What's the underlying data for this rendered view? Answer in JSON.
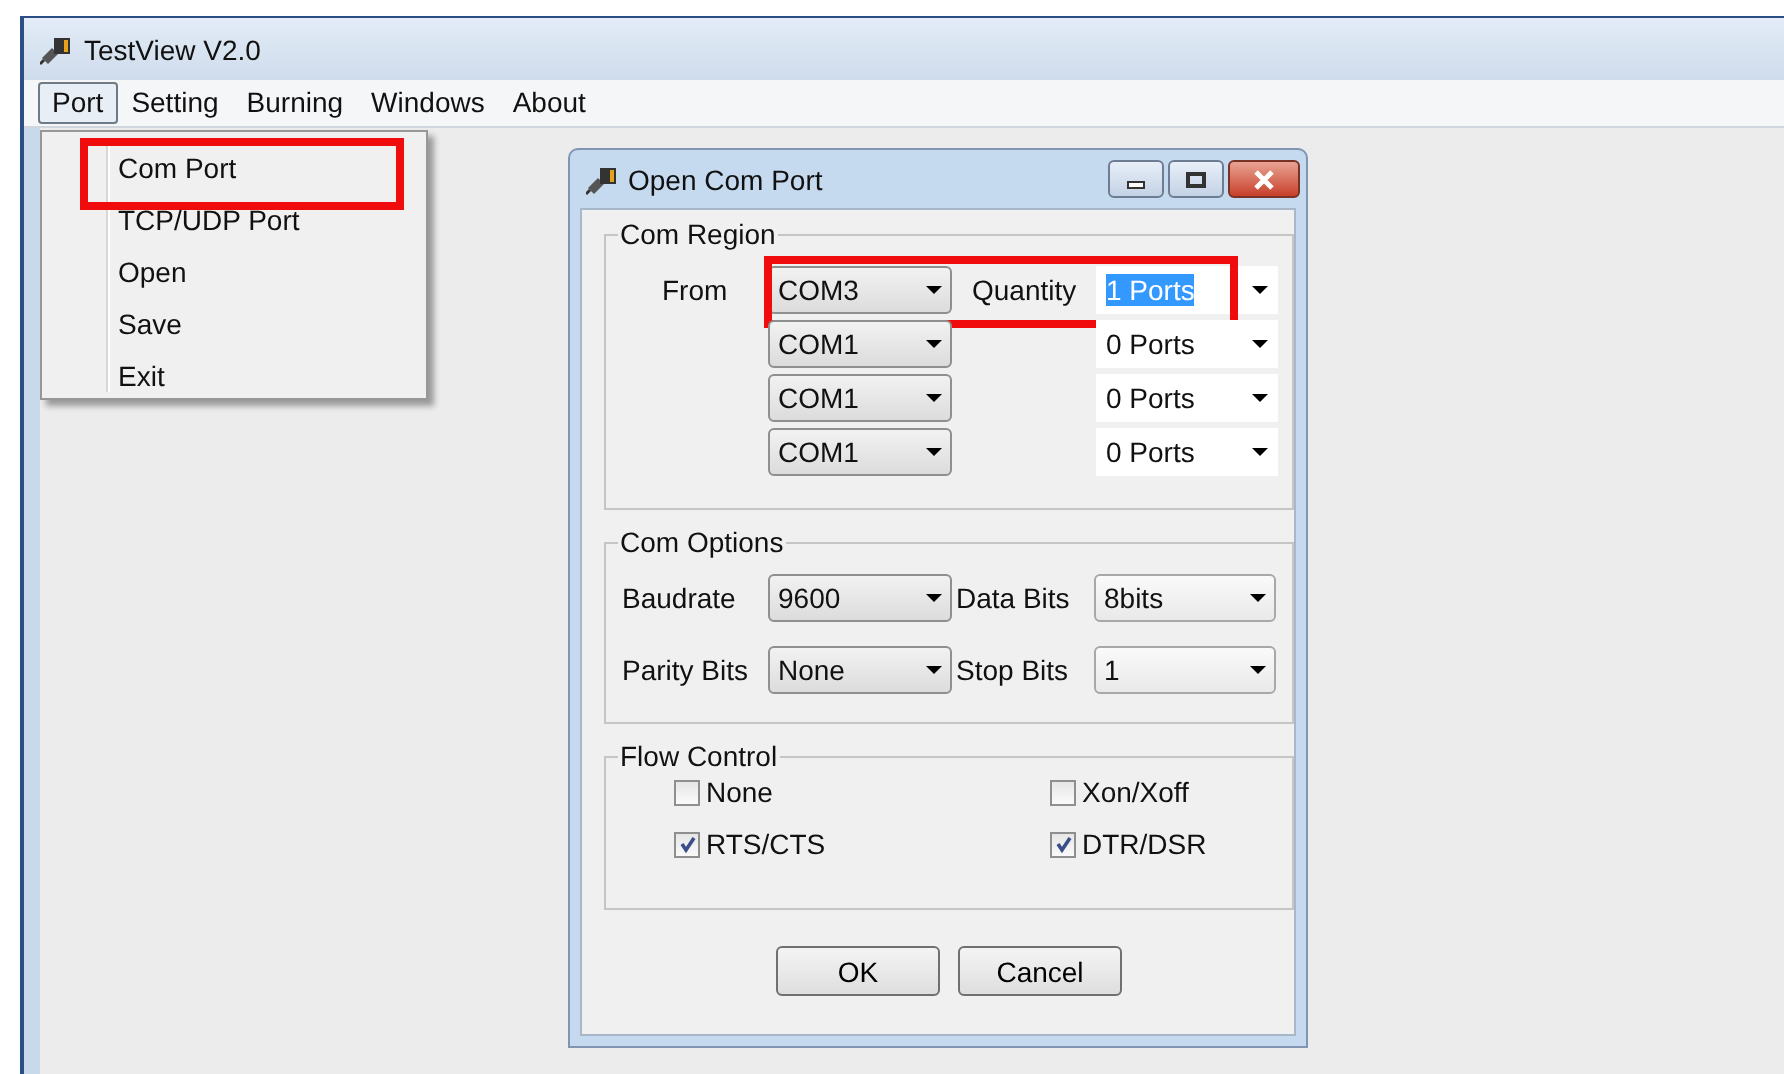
{
  "window": {
    "title": "TestView V2.0"
  },
  "menu_bar": [
    {
      "label": "Port",
      "selected": true
    },
    {
      "label": "Setting",
      "selected": false
    },
    {
      "label": "Burning",
      "selected": false
    },
    {
      "label": "Windows",
      "selected": false
    },
    {
      "label": "About",
      "selected": false
    }
  ],
  "port_menu": {
    "items": [
      {
        "label": "Com Port",
        "annotated": true
      },
      {
        "label": "TCP/UDP Port",
        "annotated": false
      },
      {
        "label": "Open",
        "annotated": false
      },
      {
        "label": "Save",
        "annotated": false
      },
      {
        "label": "Exit",
        "annotated": false
      }
    ]
  },
  "dialog": {
    "title": "Open Com Port",
    "com_region": {
      "title": "Com Region",
      "from_label": "From",
      "quantity_label": "Quantity",
      "rows": [
        {
          "port": "COM3",
          "quantity": "1 Ports",
          "quantity_text_selected": true,
          "annotated": true
        },
        {
          "port": "COM1",
          "quantity": "0 Ports",
          "quantity_text_selected": false,
          "annotated": false
        },
        {
          "port": "COM1",
          "quantity": "0 Ports",
          "quantity_text_selected": false,
          "annotated": false
        },
        {
          "port": "COM1",
          "quantity": "0 Ports",
          "quantity_text_selected": false,
          "annotated": false
        }
      ]
    },
    "com_options": {
      "title": "Com Options",
      "fields": [
        {
          "label": "Baudrate",
          "value": "9600"
        },
        {
          "label": "Data Bits",
          "value": "8bits"
        },
        {
          "label": "Parity Bits",
          "value": "None"
        },
        {
          "label": "Stop Bits",
          "value": "1"
        }
      ]
    },
    "flow_control": {
      "title": "Flow Control",
      "options": [
        {
          "label": "None",
          "checked": false
        },
        {
          "label": "Xon/Xoff",
          "checked": false
        },
        {
          "label": "RTS/CTS",
          "checked": true
        },
        {
          "label": "DTR/DSR",
          "checked": true
        }
      ]
    },
    "buttons": [
      "OK",
      "Cancel"
    ]
  }
}
